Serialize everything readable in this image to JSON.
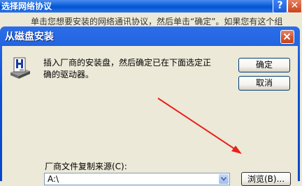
{
  "background_window": {
    "title": "选择网络协议",
    "help_glyph": "?",
    "close_glyph": "✕",
    "instruction": "单击您想要安装的网络通讯协议，然后单击“确定”。如果您有这个组"
  },
  "dialog": {
    "title": "从磁盘安装",
    "message": "插入厂商的安装盘，然后确定已在下面选定正确的驱动器。",
    "ok_label": "确定",
    "cancel_label": "取消",
    "source_label": "厂商文件复制来源(C):",
    "path_value": "A:\\",
    "browse_label": "浏览(B)..."
  },
  "colors": {
    "titlebar": "#0454d0",
    "close": "#c8431c",
    "annotation_arrow": "#e8231c"
  }
}
